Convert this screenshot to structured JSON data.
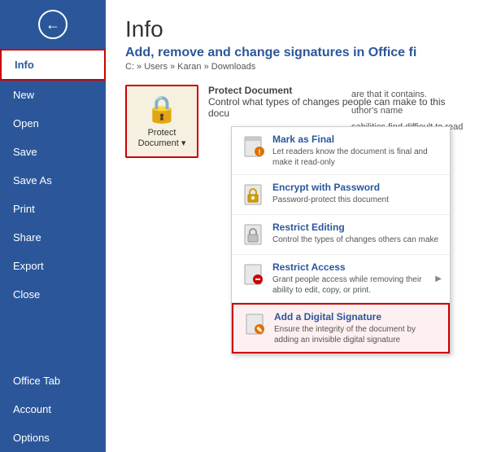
{
  "sidebar": {
    "items": [
      {
        "label": "Info",
        "active": true
      },
      {
        "label": "New",
        "active": false
      },
      {
        "label": "Open",
        "active": false
      },
      {
        "label": "Save",
        "active": false
      },
      {
        "label": "Save As",
        "active": false
      },
      {
        "label": "Print",
        "active": false
      },
      {
        "label": "Share",
        "active": false
      },
      {
        "label": "Export",
        "active": false
      },
      {
        "label": "Close",
        "active": false
      },
      {
        "label": "Office Tab",
        "active": false
      },
      {
        "label": "Account",
        "active": false
      },
      {
        "label": "Options",
        "active": false
      }
    ]
  },
  "main": {
    "title": "Info",
    "section_title": "Add, remove and change signatures in Office fi",
    "breadcrumb": "C: » Users » Karan » Downloads",
    "protect_document": {
      "label": "Protect\nDocument ▾",
      "description": "Control what types of changes people can make to this docu"
    }
  },
  "dropdown": {
    "items": [
      {
        "title": "Mark as Final",
        "description": "Let readers know the document is final and make it read-only",
        "icon": "📄"
      },
      {
        "title": "Encrypt with Password",
        "description": "Password-protect this document",
        "icon": "🔒"
      },
      {
        "title": "Restrict Editing",
        "description": "Control the types of changes others can make",
        "icon": "📋"
      },
      {
        "title": "Restrict Access",
        "description": "Grant people access while removing their ability to edit, copy, or print.",
        "icon": "🔐",
        "has_arrow": true
      },
      {
        "title": "Add a Digital Signature",
        "description": "Ensure the integrity of the document by adding an invisible digital signature",
        "icon": "✍️",
        "highlighted": true
      }
    ]
  },
  "info_right": {
    "items": [
      "are that it contains.",
      "uthor's name",
      "sabilities find difficult to read"
    ]
  },
  "icons": {
    "back": "←",
    "protect": "🔒"
  }
}
